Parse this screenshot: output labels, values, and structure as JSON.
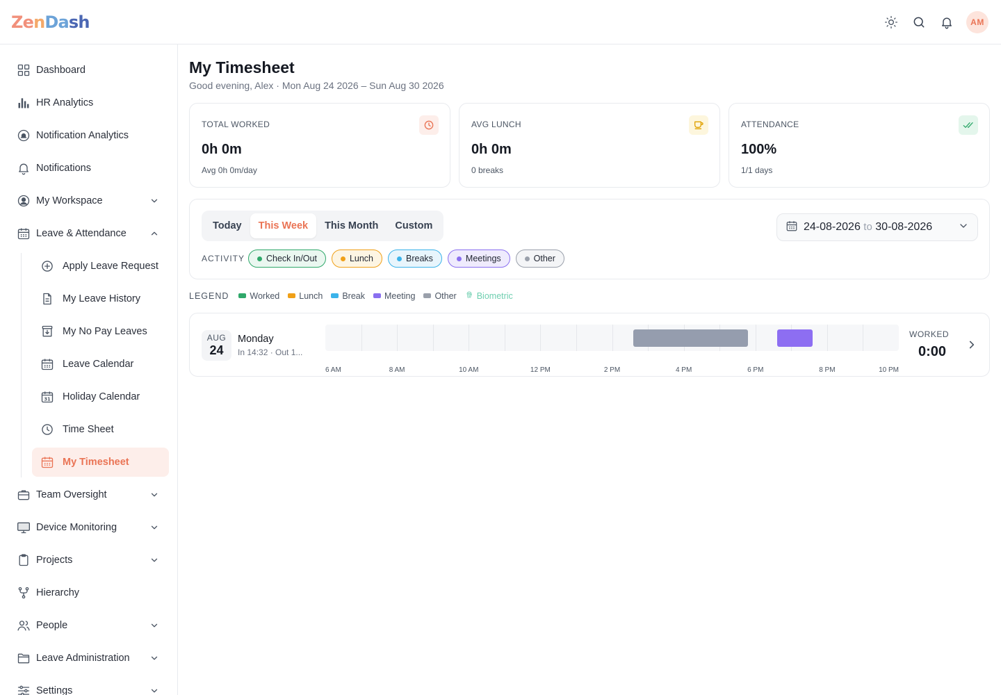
{
  "app": {
    "logo": [
      "Ze",
      "n",
      "Da",
      "sh"
    ]
  },
  "header": {
    "user_initials": "AM",
    "icons": [
      "sun-icon",
      "search-icon",
      "bell-icon"
    ]
  },
  "sidebar": {
    "items": [
      {
        "label": "Dashboard",
        "icon": "grid-icon"
      },
      {
        "label": "HR Analytics",
        "icon": "bar-chart-icon"
      },
      {
        "label": "Notification Analytics",
        "icon": "bell-circle-icon"
      },
      {
        "label": "Notifications",
        "icon": "bell-icon"
      },
      {
        "label": "My Workspace",
        "icon": "user-circle-icon",
        "expandable": true
      },
      {
        "label": "Leave & Attendance",
        "icon": "calendar-icon",
        "expandable": true,
        "expanded": true
      },
      {
        "label": "Team Oversight",
        "icon": "briefcase-icon",
        "expandable": true
      },
      {
        "label": "Device Monitoring",
        "icon": "monitor-icon",
        "expandable": true
      },
      {
        "label": "Projects",
        "icon": "clipboard-icon",
        "expandable": true
      },
      {
        "label": "Hierarchy",
        "icon": "hierarchy-icon"
      },
      {
        "label": "People",
        "icon": "people-icon",
        "expandable": true
      },
      {
        "label": "Leave Administration",
        "icon": "folder-icon",
        "expandable": true
      },
      {
        "label": "Settings",
        "icon": "sliders-icon",
        "expandable": true
      }
    ],
    "sub_items": [
      {
        "label": "Apply Leave Request",
        "icon": "plus-circle-icon"
      },
      {
        "label": "My Leave History",
        "icon": "document-icon"
      },
      {
        "label": "My No Pay Leaves",
        "icon": "archive-icon"
      },
      {
        "label": "Leave Calendar",
        "icon": "calendar-grid-icon"
      },
      {
        "label": "Holiday Calendar",
        "icon": "calendar-31-icon"
      },
      {
        "label": "Time Sheet",
        "icon": "clock-icon"
      },
      {
        "label": "My Timesheet",
        "icon": "calendar-grid-icon",
        "active": true
      }
    ]
  },
  "page": {
    "title": "My Timesheet",
    "subtitle": "Good evening, Alex · Mon Aug 24 2026 – Sun Aug 30 2026"
  },
  "stats": [
    {
      "label": "TOTAL WORKED",
      "value": "0h 0m",
      "note": "Avg 0h 0m/day",
      "icon": "clock-icon",
      "color": "#ea7455",
      "bg": "#fdeeea"
    },
    {
      "label": "AVG LUNCH",
      "value": "0h 0m",
      "note": "0 breaks",
      "icon": "coffee-icon",
      "color": "#e0a100",
      "bg": "#fdf6dd"
    },
    {
      "label": "ATTENDANCE",
      "value": "100%",
      "note": "1/1 days",
      "icon": "double-check-icon",
      "color": "#2fa86a",
      "bg": "#e4f6ec"
    }
  ],
  "filters": {
    "tabs": [
      "Today",
      "This Week",
      "This Month",
      "Custom"
    ],
    "active_tab": "This Week",
    "date_from": "24-08-2026",
    "date_sep": "to",
    "date_to": "30-08-2026",
    "activity_label": "ACTIVITY",
    "chips": [
      {
        "label": "Check In/Out",
        "color": "#2fa86a",
        "bg": "#eaf7f0"
      },
      {
        "label": "Lunch",
        "color": "#f0a017",
        "bg": "#fdf5e3"
      },
      {
        "label": "Breaks",
        "color": "#3bb3ea",
        "bg": "#e8f5fc"
      },
      {
        "label": "Meetings",
        "color": "#8a6ff0",
        "bg": "#efebfd"
      },
      {
        "label": "Other",
        "color": "#9aa0ab",
        "bg": "#f4f5f7"
      }
    ]
  },
  "legend": {
    "title": "LEGEND",
    "items": [
      {
        "label": "Worked",
        "color": "#2fa86a"
      },
      {
        "label": "Lunch",
        "color": "#f0a017"
      },
      {
        "label": "Break",
        "color": "#3bb3ea"
      },
      {
        "label": "Meeting",
        "color": "#8a6ff0"
      },
      {
        "label": "Other",
        "color": "#9aa0ab"
      }
    ],
    "biometric_label": "Biometric",
    "biometric_color": "#6fcfb0"
  },
  "days": [
    {
      "month": "AUG",
      "day": "24",
      "weekday": "Monday",
      "meta": "In 14:32 · Out 1...",
      "worked_label": "WORKED",
      "worked_value": "0:00",
      "timeline_start_hour": 6,
      "timeline_end_hour": 22,
      "ticks": [
        "6 AM",
        "8 AM",
        "10 AM",
        "12 PM",
        "2 PM",
        "4 PM",
        "6 PM",
        "8 PM",
        "10 PM"
      ],
      "segments": [
        {
          "type": "Other",
          "start": "14:36",
          "end": "17:48",
          "color": "#959dae"
        },
        {
          "type": "Meeting",
          "start": "18:36",
          "end": "19:36",
          "color": "#8d6ef2"
        }
      ]
    }
  ]
}
